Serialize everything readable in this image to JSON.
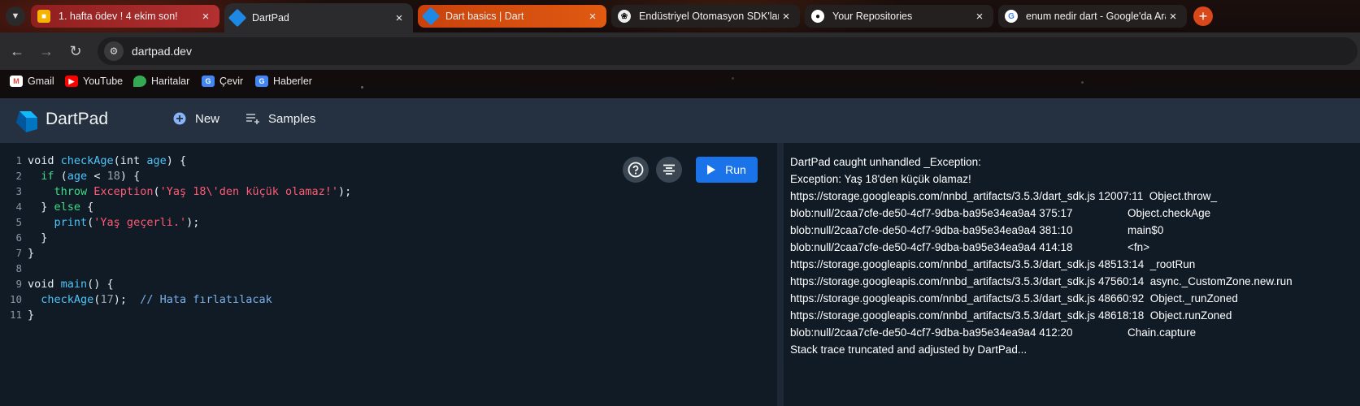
{
  "browser": {
    "tabs": [
      {
        "title": "1. hafta ödev ! 4 ekim son!",
        "favicon": "slides-icon"
      },
      {
        "title": "DartPad",
        "favicon": "dart-icon"
      },
      {
        "title": "Dart basics | Dart",
        "favicon": "dart-icon"
      },
      {
        "title": "Endüstriyel Otomasyon SDK'ları",
        "favicon": "chatgpt-icon"
      },
      {
        "title": "Your Repositories",
        "favicon": "github-icon"
      },
      {
        "title": "enum nedir dart - Google'da Ara",
        "favicon": "google-icon"
      }
    ],
    "url": "dartpad.dev",
    "bookmarks": [
      "Gmail",
      "YouTube",
      "Haritalar",
      "Çevir",
      "Haberler"
    ]
  },
  "app": {
    "title": "DartPad",
    "new_label": "New",
    "samples_label": "Samples",
    "run_label": "Run"
  },
  "editor": {
    "line_numbers": [
      "1",
      "2",
      "3",
      "4",
      "5",
      "6",
      "7",
      "8",
      "9",
      "10",
      "11"
    ],
    "lines": [
      "void checkAge(int age) {",
      "  if (age < 18) {",
      "    throw Exception('Yaş 18\\'den küçük olamaz!');",
      "  } else {",
      "    print('Yaş geçerli.');",
      "  }",
      "}",
      "",
      "void main() {",
      "  checkAge(17);  // Hata fırlatılacak",
      "}"
    ]
  },
  "console": {
    "lines": [
      "DartPad caught unhandled _Exception:",
      "Exception: Yaş 18'den küçük olamaz!",
      "https://storage.googleapis.com/nnbd_artifacts/3.5.3/dart_sdk.js 12007:11  Object.throw_",
      "blob:null/2caa7cfe-de50-4cf7-9dba-ba95e34ea9a4 375:17                  Object.checkAge",
      "blob:null/2caa7cfe-de50-4cf7-9dba-ba95e34ea9a4 381:10                  main$0",
      "blob:null/2caa7cfe-de50-4cf7-9dba-ba95e34ea9a4 414:18                  <fn>",
      "https://storage.googleapis.com/nnbd_artifacts/3.5.3/dart_sdk.js 48513:14  _rootRun",
      "https://storage.googleapis.com/nnbd_artifacts/3.5.3/dart_sdk.js 47560:14  async._CustomZone.new.run",
      "https://storage.googleapis.com/nnbd_artifacts/3.5.3/dart_sdk.js 48660:92  Object._runZoned",
      "https://storage.googleapis.com/nnbd_artifacts/3.5.3/dart_sdk.js 48618:18  Object.runZoned",
      "blob:null/2caa7cfe-de50-4cf7-9dba-ba95e34ea9a4 412:20                  Chain.capture",
      "Stack trace truncated and adjusted by DartPad..."
    ]
  },
  "colors": {
    "accent": "#1a73e8",
    "header_bg": "#253140",
    "editor_bg": "#111b26"
  }
}
